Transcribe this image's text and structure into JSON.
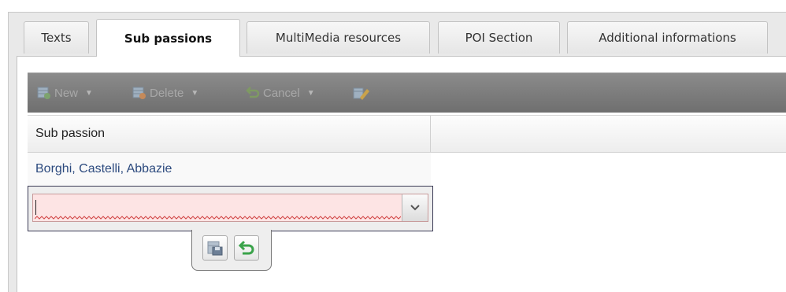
{
  "tabs": [
    {
      "label": "Texts",
      "active": false
    },
    {
      "label": "Sub passions",
      "active": true
    },
    {
      "label": "MultiMedia resources",
      "active": false
    },
    {
      "label": "POI Section",
      "active": false
    },
    {
      "label": "Additional informations",
      "active": false
    }
  ],
  "toolbar": {
    "new_label": "New",
    "delete_label": "Delete",
    "cancel_label": "Cancel",
    "disabled": true
  },
  "grid": {
    "column_header": "Sub passion",
    "rows": [
      "Borghi, Castelli, Abbazie"
    ]
  },
  "editor": {
    "combo_value": "",
    "invalid": true
  },
  "colors": {
    "toolbar_bg": "#7d7d7d",
    "row_text": "#2c4a7e",
    "invalid_bg": "#fde4e4",
    "cancel_green": "#3aa34a"
  }
}
